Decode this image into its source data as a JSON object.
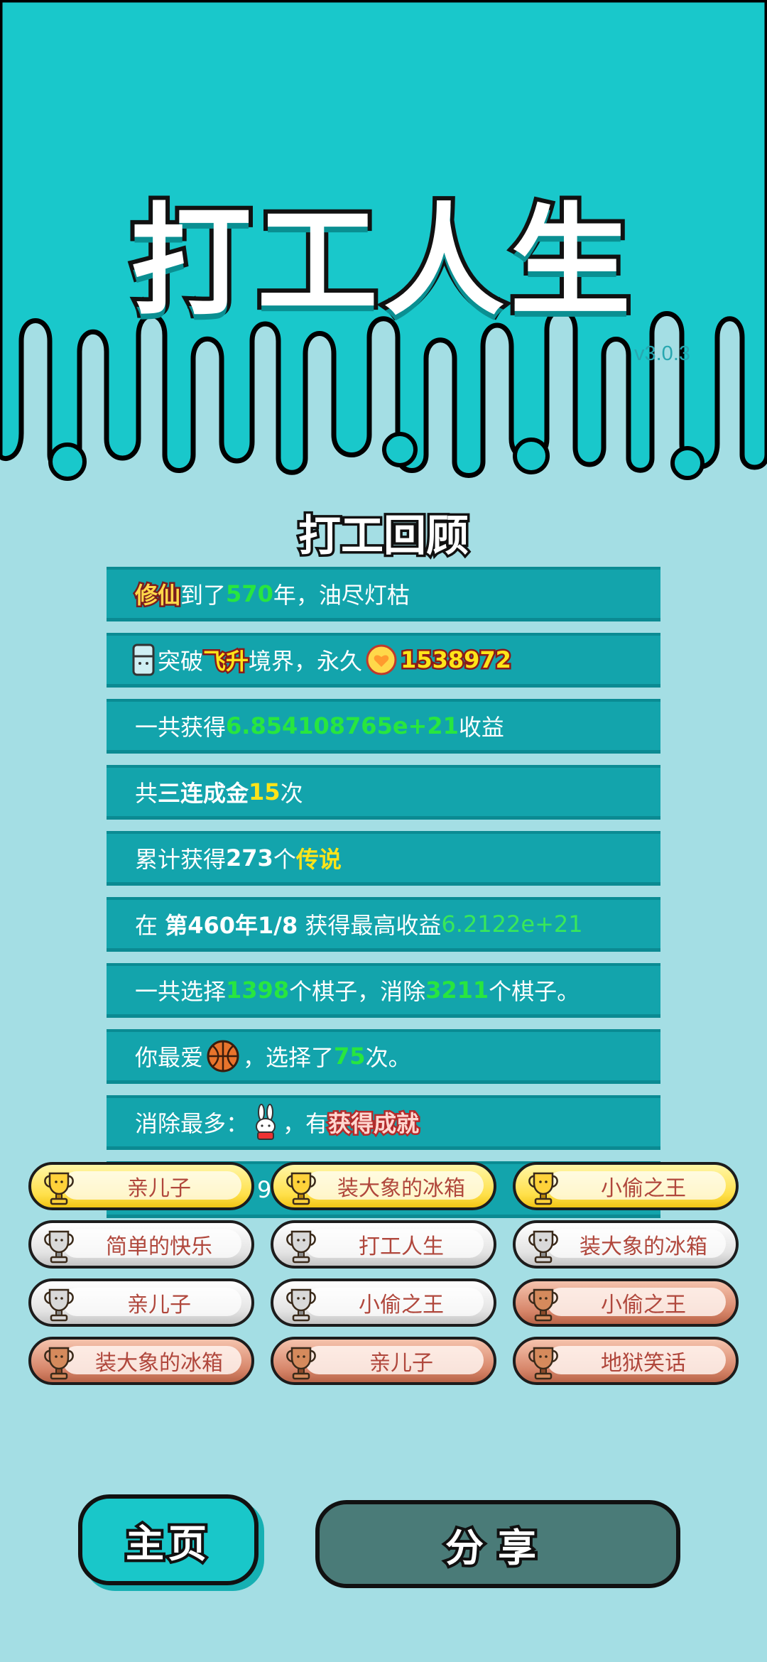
{
  "app": {
    "title": "打工人生",
    "version": "v3.0.3",
    "review_title": "打工回顾"
  },
  "stats": {
    "r1": {
      "label": "修仙",
      "text1": "到了",
      "years": "570",
      "text2": "年，油尽灯枯"
    },
    "r2": {
      "text1": "突破",
      "realm": "飞升",
      "text2": "境界，永久",
      "value": "1538972"
    },
    "r3": {
      "text1": "一共获得",
      "value": "6.854108765e+21",
      "text2": "收益"
    },
    "r4": {
      "text1": "共",
      "bold": "三连成金",
      "count": "15",
      "text2": "次"
    },
    "r5": {
      "text1": "累计获得",
      "count": "273",
      "text2": "个",
      "legend": "传说"
    },
    "r6": {
      "text1": "在",
      "when": "第460年1/8",
      "text2": "获得最高收益",
      "value": "6.2122e+21"
    },
    "r7": {
      "text1": "一共选择",
      "chosen": "1398",
      "text2": "个棋子，消除",
      "removed": "3211",
      "text3": "个棋子。"
    },
    "r8": {
      "text1": "你最爱",
      "text2": "，选择了",
      "count": "75",
      "text3": "次。"
    },
    "r9": {
      "text1": "消除最多：",
      "text2": "，有",
      "achieve": "获得成就"
    },
    "r10": {
      "partial": "9"
    }
  },
  "achievements": [
    {
      "label": "亲儿子",
      "tier": "gold"
    },
    {
      "label": "装大象的冰箱",
      "tier": "gold"
    },
    {
      "label": "小偷之王",
      "tier": "gold"
    },
    {
      "label": "简单的快乐",
      "tier": "silver"
    },
    {
      "label": "打工人生",
      "tier": "silver"
    },
    {
      "label": "装大象的冰箱",
      "tier": "silver"
    },
    {
      "label": "亲儿子",
      "tier": "silver"
    },
    {
      "label": "小偷之王",
      "tier": "silver"
    },
    {
      "label": "小偷之王",
      "tier": "bronze"
    },
    {
      "label": "装大象的冰箱",
      "tier": "bronze"
    },
    {
      "label": "亲儿子",
      "tier": "bronze"
    },
    {
      "label": "地狱笑话",
      "tier": "bronze"
    }
  ],
  "buttons": {
    "home": "主页",
    "share": "分享"
  },
  "icons": {
    "fridge": "fridge-icon",
    "heart_coin": "heart-coin-icon",
    "basketball": "basketball-icon",
    "rabbit": "rabbit-icon",
    "trophy": "trophy-icon"
  },
  "colors": {
    "header_teal": "#19c8cb",
    "background": "#a4dee4",
    "row_teal": "#13a4ac",
    "highlight_green": "#28e63f",
    "highlight_yellow": "#ffe419",
    "share_button": "#4a7b78"
  }
}
